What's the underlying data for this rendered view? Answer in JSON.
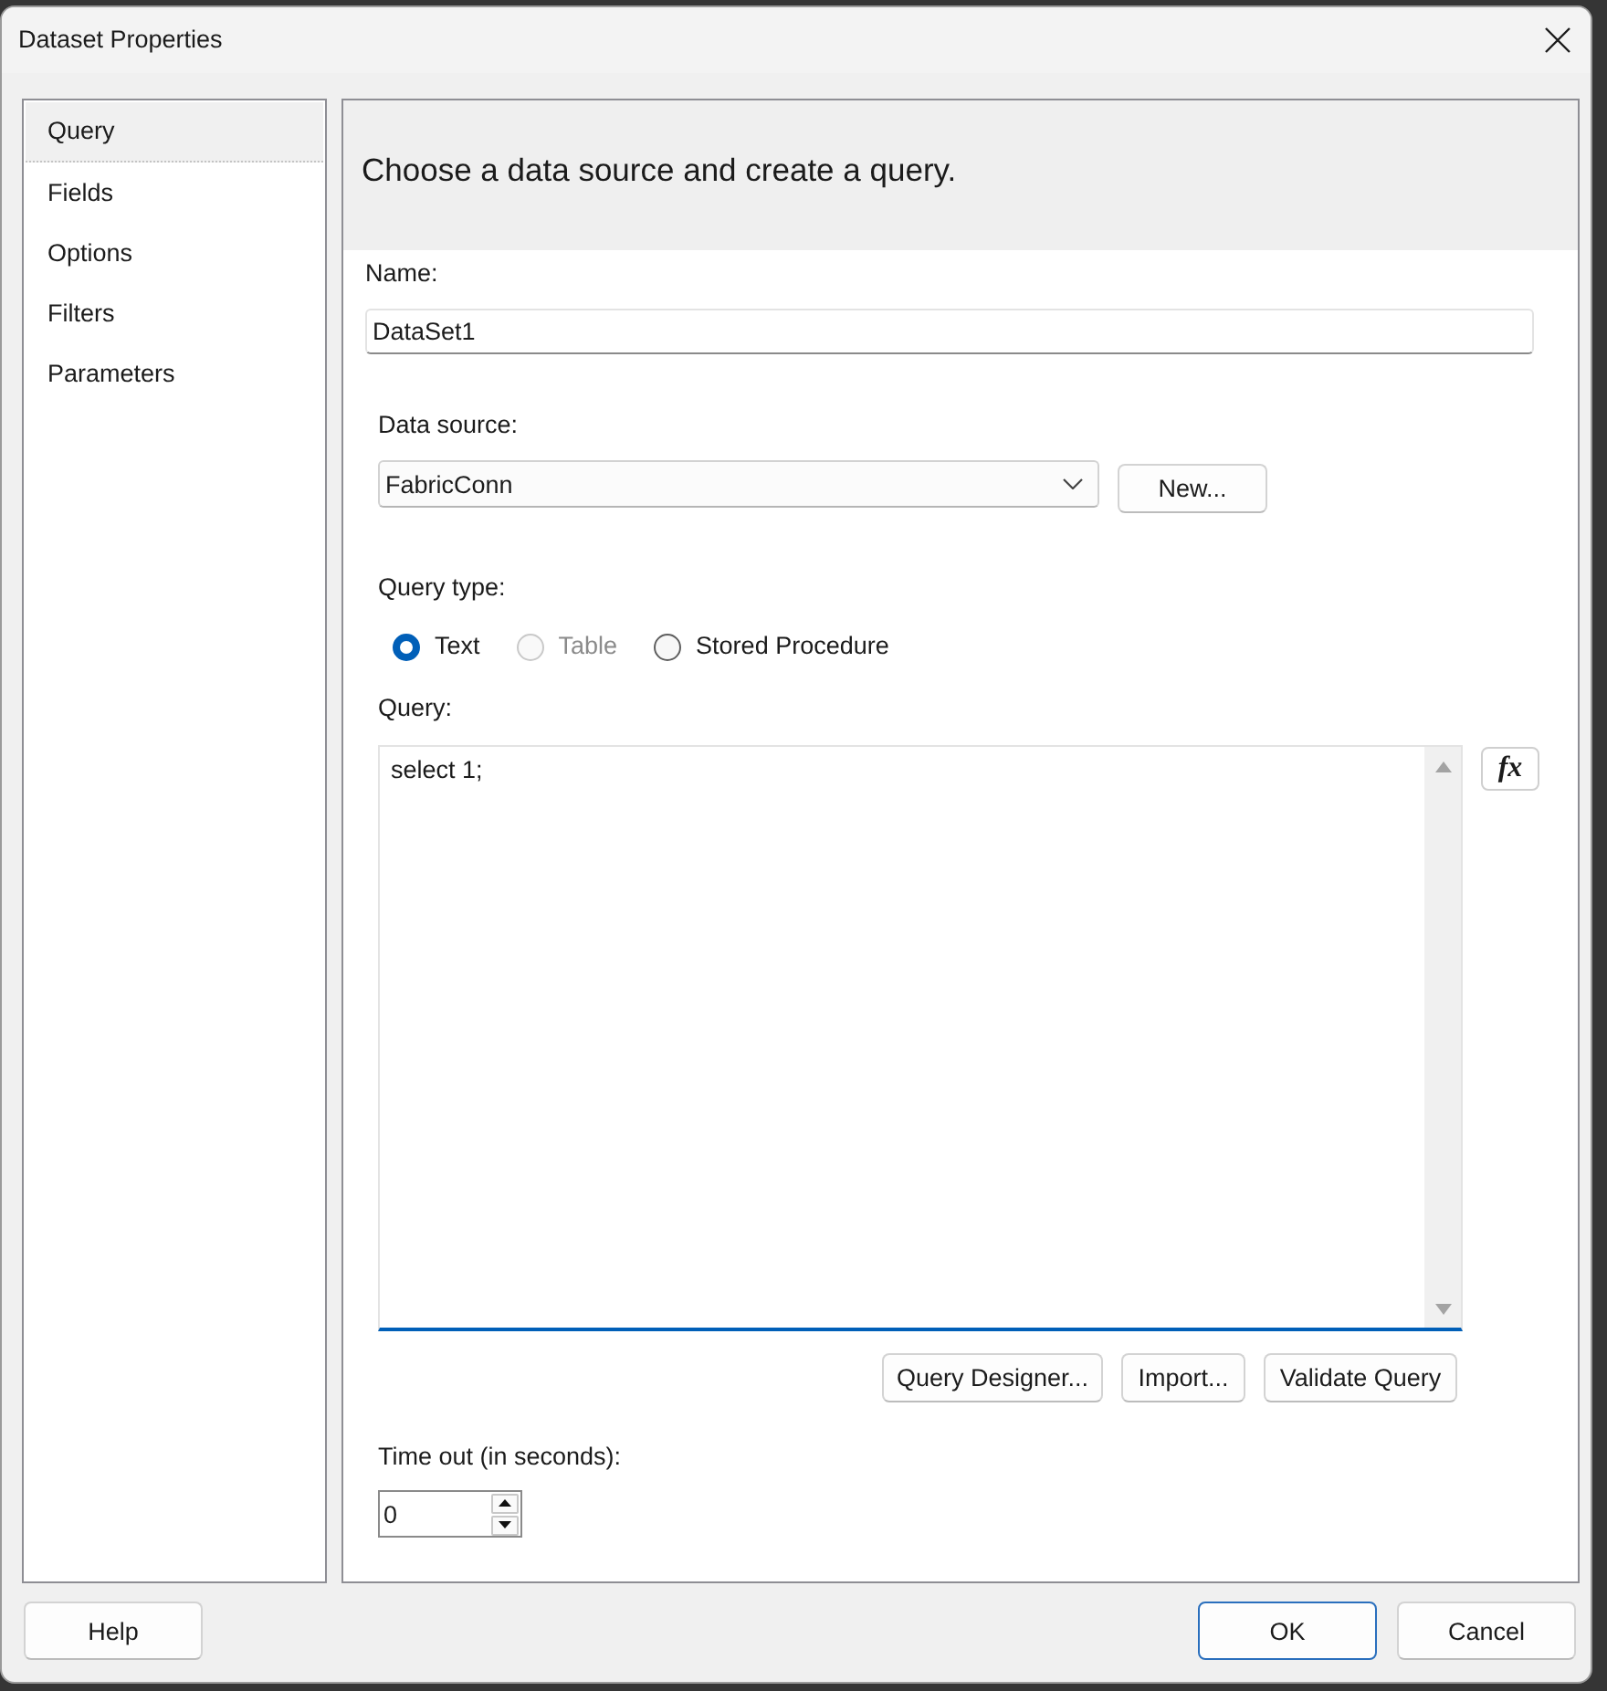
{
  "window": {
    "title": "Dataset Properties"
  },
  "sidebar": {
    "items": [
      {
        "label": "Query",
        "selected": true
      },
      {
        "label": "Fields",
        "selected": false
      },
      {
        "label": "Options",
        "selected": false
      },
      {
        "label": "Filters",
        "selected": false
      },
      {
        "label": "Parameters",
        "selected": false
      }
    ]
  },
  "header": {
    "text": "Choose a data source and create a query."
  },
  "name": {
    "label": "Name:",
    "value": "DataSet1"
  },
  "data_source": {
    "label": "Data source:",
    "value": "FabricConn",
    "new_button": "New..."
  },
  "query_type": {
    "label": "Query type:",
    "options": [
      {
        "label": "Text",
        "selected": true,
        "disabled": false
      },
      {
        "label": "Table",
        "selected": false,
        "disabled": true
      },
      {
        "label": "Stored Procedure",
        "selected": false,
        "disabled": false
      }
    ]
  },
  "query": {
    "label": "Query:",
    "value": "select 1;",
    "focused": true,
    "expression_button": "fx",
    "buttons": [
      "Query Designer...",
      "Import...",
      "Validate Query"
    ]
  },
  "timeout": {
    "label": "Time out (in seconds):",
    "value": "0"
  },
  "footer": {
    "help_button": {
      "label": "Help",
      "default": false
    },
    "ok_button": {
      "label": "OK",
      "default": true
    },
    "cancel_button": {
      "label": "Cancel",
      "default": false
    }
  }
}
